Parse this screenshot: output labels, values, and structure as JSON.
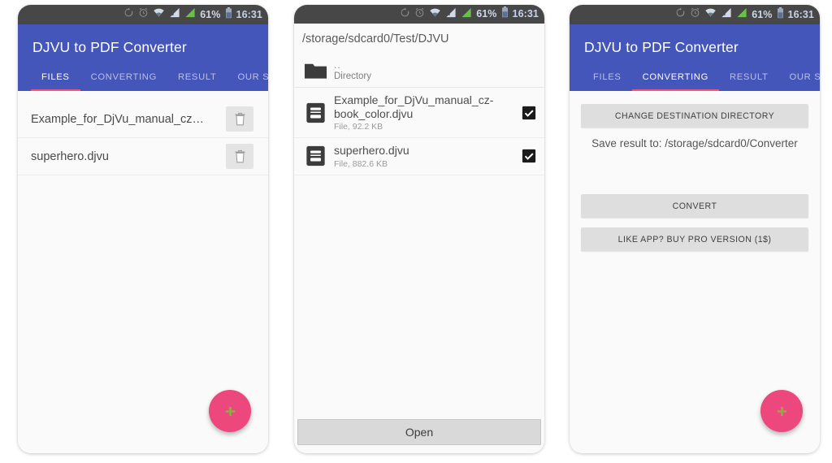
{
  "statusbar": {
    "battery_percent": "61%",
    "time": "16:31",
    "icons": [
      "rotate-icon",
      "alarm-icon",
      "wifi-icon",
      "signal-sim1-icon",
      "signal-sim2-icon",
      "battery-icon"
    ]
  },
  "app": {
    "title": "DJVU to PDF Converter",
    "tabs": [
      "FILES",
      "CONVERTING",
      "RESULT",
      "OUR SITE"
    ]
  },
  "colors": {
    "appbar": "#4456BA",
    "tab_indicator": "#F1557F",
    "fab": "#EC487D",
    "fab_icon": "#8BAF3E",
    "statusbar": "#474747",
    "screen_bg": "#FAFAFA"
  },
  "panel1": {
    "active_tab": "FILES",
    "files": [
      {
        "name": "Example_for_DjVu_manual_cz…",
        "delete_icon": "trash-icon"
      },
      {
        "name": "superhero.djvu",
        "delete_icon": "trash-icon"
      }
    ],
    "fab": {
      "icon": "plus-icon",
      "label": "Add file"
    }
  },
  "panel2": {
    "path": "/storage/sdcard0/Test/DJVU",
    "entries": [
      {
        "icon": "folder-icon",
        "title": "..",
        "subtitle": "Directory",
        "checkbox": null
      },
      {
        "icon": "file-icon",
        "title": "Example_for_DjVu_manual_cz-book_color.djvu",
        "subtitle": "File, 92.2 KB",
        "checkbox": "checked"
      },
      {
        "icon": "file-icon",
        "title": "superhero.djvu",
        "subtitle": "File, 882.6 KB",
        "checkbox": "checked"
      }
    ],
    "open_button": "Open"
  },
  "panel3": {
    "active_tab": "CONVERTING",
    "change_dir_button": "CHANGE DESTINATION DIRECTORY",
    "save_note": "Save result to: /storage/sdcard0/Converter",
    "convert_button": "CONVERT",
    "pro_button": "LIKE APP? BUY PRO VERSION (1$)",
    "fab": {
      "icon": "plus-icon",
      "label": "Add file"
    }
  }
}
